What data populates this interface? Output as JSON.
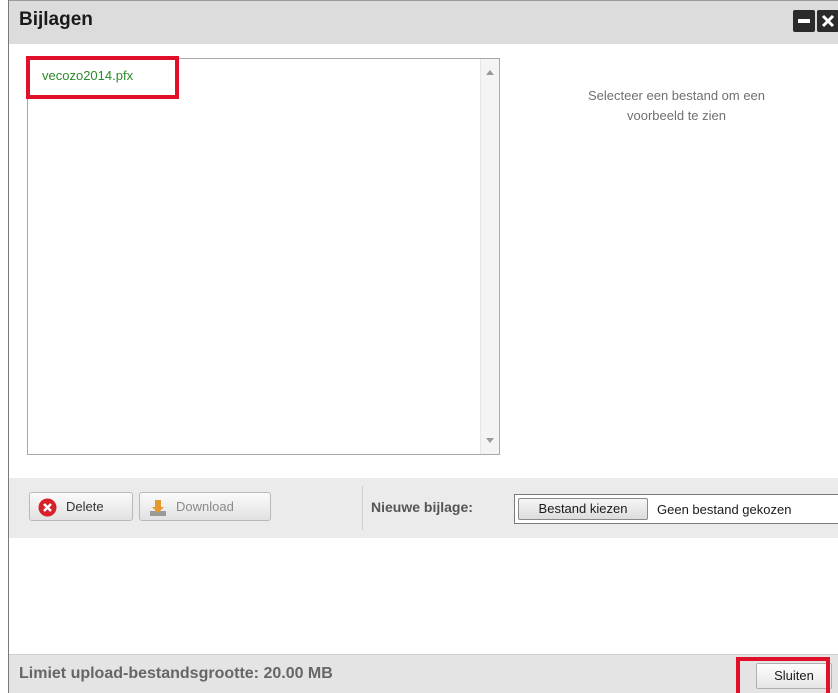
{
  "window": {
    "title": "Bijlagen",
    "minimize_icon": "minimize-icon",
    "close_icon": "close-icon"
  },
  "files": [
    {
      "name": "vecozo2014.pfx"
    }
  ],
  "preview": {
    "message_line1": "Selecteer een bestand om een",
    "message_line2": "voorbeeld te zien"
  },
  "toolbar": {
    "delete_label": "Delete",
    "delete_icon": "delete-icon",
    "download_label": "Download",
    "download_icon": "download-icon",
    "new_attachment_label": "Nieuwe bijlage:",
    "choose_file_label": "Bestand kiezen",
    "no_file_label": "Geen bestand gekozen"
  },
  "footer": {
    "limit_text": "Limiet upload-bestandsgrootte: 20.00 MB",
    "close_label": "Sluiten"
  },
  "colors": {
    "highlight": "#e0102a",
    "file_link": "#2a8a2a",
    "titlebar": "#dcdcdc"
  }
}
